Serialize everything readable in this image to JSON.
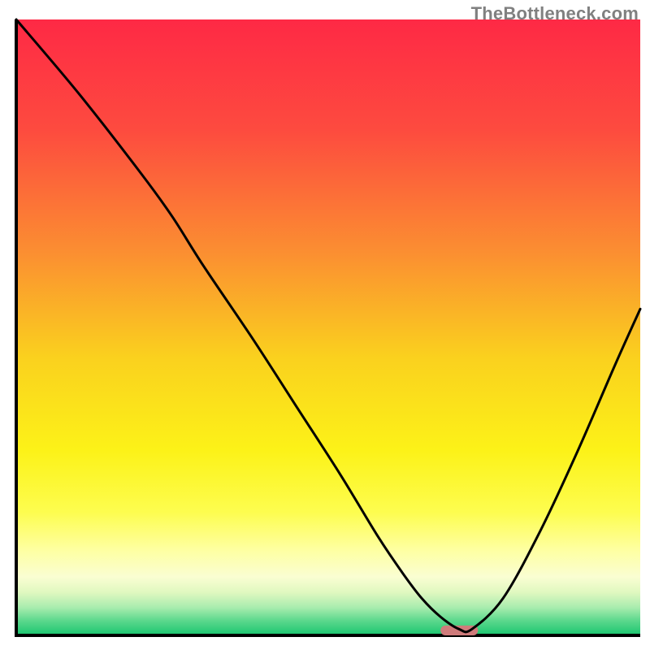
{
  "watermark": "TheBottleneck.com",
  "chart_data": {
    "type": "line",
    "title": "",
    "xlabel": "",
    "ylabel": "",
    "xlim": [
      0,
      100
    ],
    "ylim": [
      0,
      100
    ],
    "grid": false,
    "legend": false,
    "series": [
      {
        "name": "bottleneck-curve",
        "x": [
          0,
          10,
          20,
          25,
          30,
          38,
          45,
          52,
          58,
          62,
          65,
          68,
          71,
          73,
          78,
          84,
          90,
          96,
          100
        ],
        "y": [
          100,
          88,
          75,
          68,
          60,
          48,
          37,
          26,
          16,
          10,
          6,
          3,
          1,
          1,
          6,
          17,
          30,
          44,
          53
        ]
      }
    ],
    "marker": {
      "name": "optimal-marker",
      "x": 71,
      "y": 0.8,
      "width": 6,
      "height": 1.6,
      "color": "#cf7b7b"
    },
    "gradient_stops": [
      {
        "offset": 0.0,
        "color": "#fe2945"
      },
      {
        "offset": 0.18,
        "color": "#fd4b3f"
      },
      {
        "offset": 0.38,
        "color": "#fb8f31"
      },
      {
        "offset": 0.55,
        "color": "#fad11e"
      },
      {
        "offset": 0.7,
        "color": "#fcf218"
      },
      {
        "offset": 0.8,
        "color": "#fdfd4f"
      },
      {
        "offset": 0.86,
        "color": "#feffa0"
      },
      {
        "offset": 0.905,
        "color": "#fafed2"
      },
      {
        "offset": 0.93,
        "color": "#e0f8c0"
      },
      {
        "offset": 0.955,
        "color": "#a8ecae"
      },
      {
        "offset": 0.975,
        "color": "#5fd98e"
      },
      {
        "offset": 1.0,
        "color": "#19c56f"
      }
    ],
    "axis_color": "#000000",
    "line_color": "#000000",
    "line_width": 3
  }
}
